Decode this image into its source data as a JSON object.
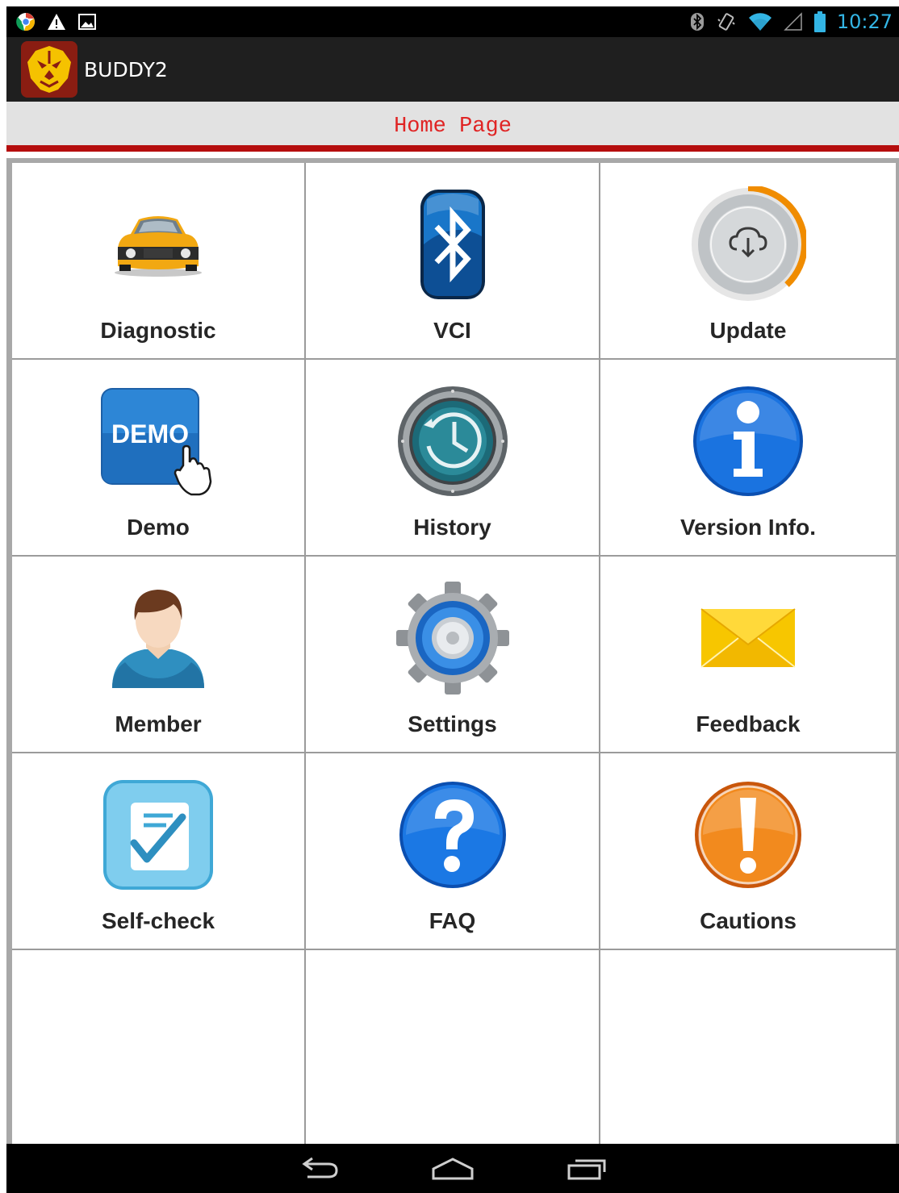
{
  "status_bar": {
    "time": "10:27",
    "left_icons": [
      "chrome-icon",
      "warning-icon",
      "image-icon"
    ],
    "right_icons": [
      "bluetooth-icon",
      "vibrate-icon",
      "wifi-icon",
      "signal-icon",
      "battery-icon"
    ],
    "time_color": "#33b5e5"
  },
  "action_bar": {
    "app_title": "BUDDY2",
    "logo_icon": "lion-logo-icon"
  },
  "header": {
    "title": "Home Page",
    "title_color": "#e02424",
    "accent_color": "#b50d0d"
  },
  "menu": {
    "items": [
      {
        "label": "Diagnostic",
        "icon": "car-icon"
      },
      {
        "label": "VCI",
        "icon": "bluetooth-icon"
      },
      {
        "label": "Update",
        "icon": "cloud-download-icon"
      },
      {
        "label": "Demo",
        "icon": "demo-icon"
      },
      {
        "label": "History",
        "icon": "history-clock-icon"
      },
      {
        "label": "Version Info.",
        "icon": "info-icon"
      },
      {
        "label": "Member",
        "icon": "user-icon"
      },
      {
        "label": "Settings",
        "icon": "gear-icon"
      },
      {
        "label": "Feedback",
        "icon": "envelope-icon"
      },
      {
        "label": "Self-check",
        "icon": "checklist-icon"
      },
      {
        "label": "FAQ",
        "icon": "question-icon"
      },
      {
        "label": "Cautions",
        "icon": "exclamation-icon"
      }
    ],
    "demo_badge_text": "DEMO"
  },
  "nav_bar": {
    "icons": [
      "back-icon",
      "home-icon",
      "recents-icon"
    ]
  }
}
